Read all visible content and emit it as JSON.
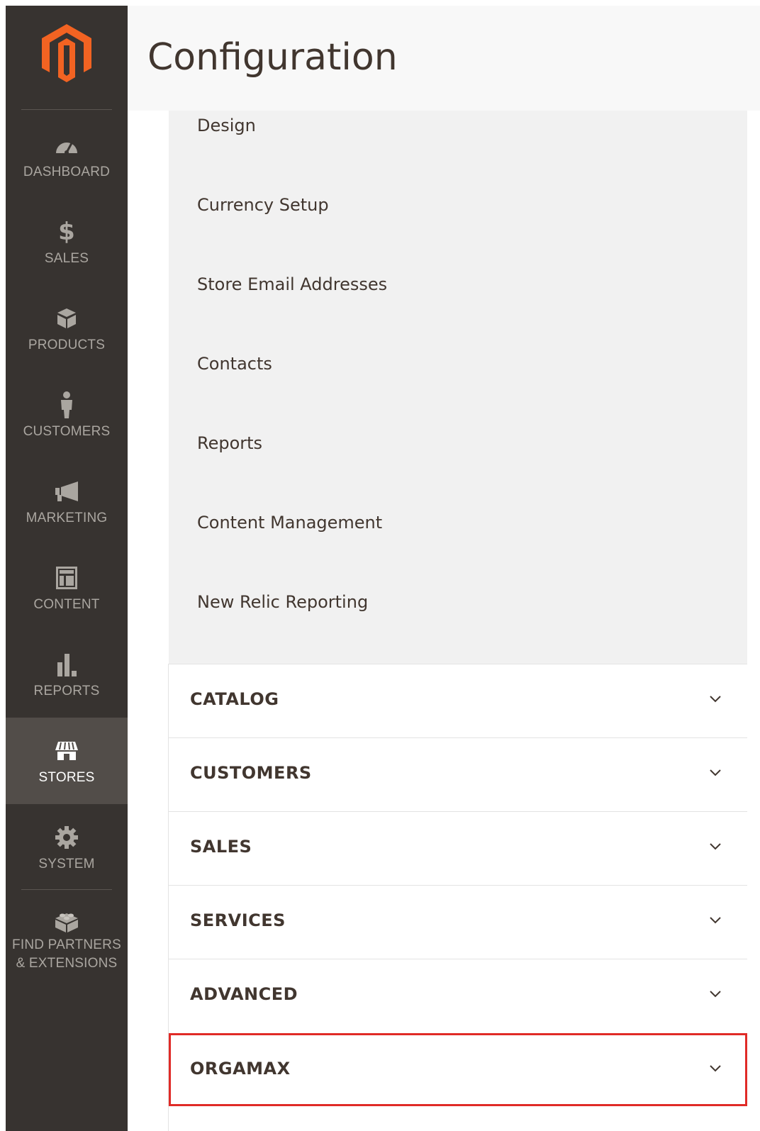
{
  "header": {
    "title": "Configuration"
  },
  "sidebar": {
    "logo": "magento-logo-icon",
    "items": [
      {
        "label": "DASHBOARD",
        "icon": "speedometer-icon"
      },
      {
        "label": "SALES",
        "icon": "dollar-icon"
      },
      {
        "label": "PRODUCTS",
        "icon": "box-icon"
      },
      {
        "label": "CUSTOMERS",
        "icon": "person-icon"
      },
      {
        "label": "MARKETING",
        "icon": "megaphone-icon"
      },
      {
        "label": "CONTENT",
        "icon": "layout-icon"
      },
      {
        "label": "REPORTS",
        "icon": "bar-chart-icon"
      },
      {
        "label": "STORES",
        "icon": "storefront-icon",
        "active": true
      },
      {
        "label": "SYSTEM",
        "icon": "gear-icon"
      },
      {
        "label_line1": "FIND PARTNERS",
        "label_line2": "& EXTENSIONS",
        "icon": "lego-brick-icon"
      }
    ]
  },
  "general_submenu": {
    "items": [
      "Design",
      "Currency Setup",
      "Store Email Addresses",
      "Contacts",
      "Reports",
      "Content Management",
      "New Relic Reporting"
    ]
  },
  "sections": [
    {
      "title": "CATALOG"
    },
    {
      "title": "CUSTOMERS"
    },
    {
      "title": "SALES"
    },
    {
      "title": "SERVICES"
    },
    {
      "title": "ADVANCED"
    },
    {
      "title": "ORGAMAX",
      "highlighted": true
    }
  ],
  "colors": {
    "sidebar_bg": "#373330",
    "sidebar_active_bg": "#524d49",
    "logo_orange": "#f26322",
    "highlight_border": "#e02b27",
    "text_dark": "#41362f"
  }
}
